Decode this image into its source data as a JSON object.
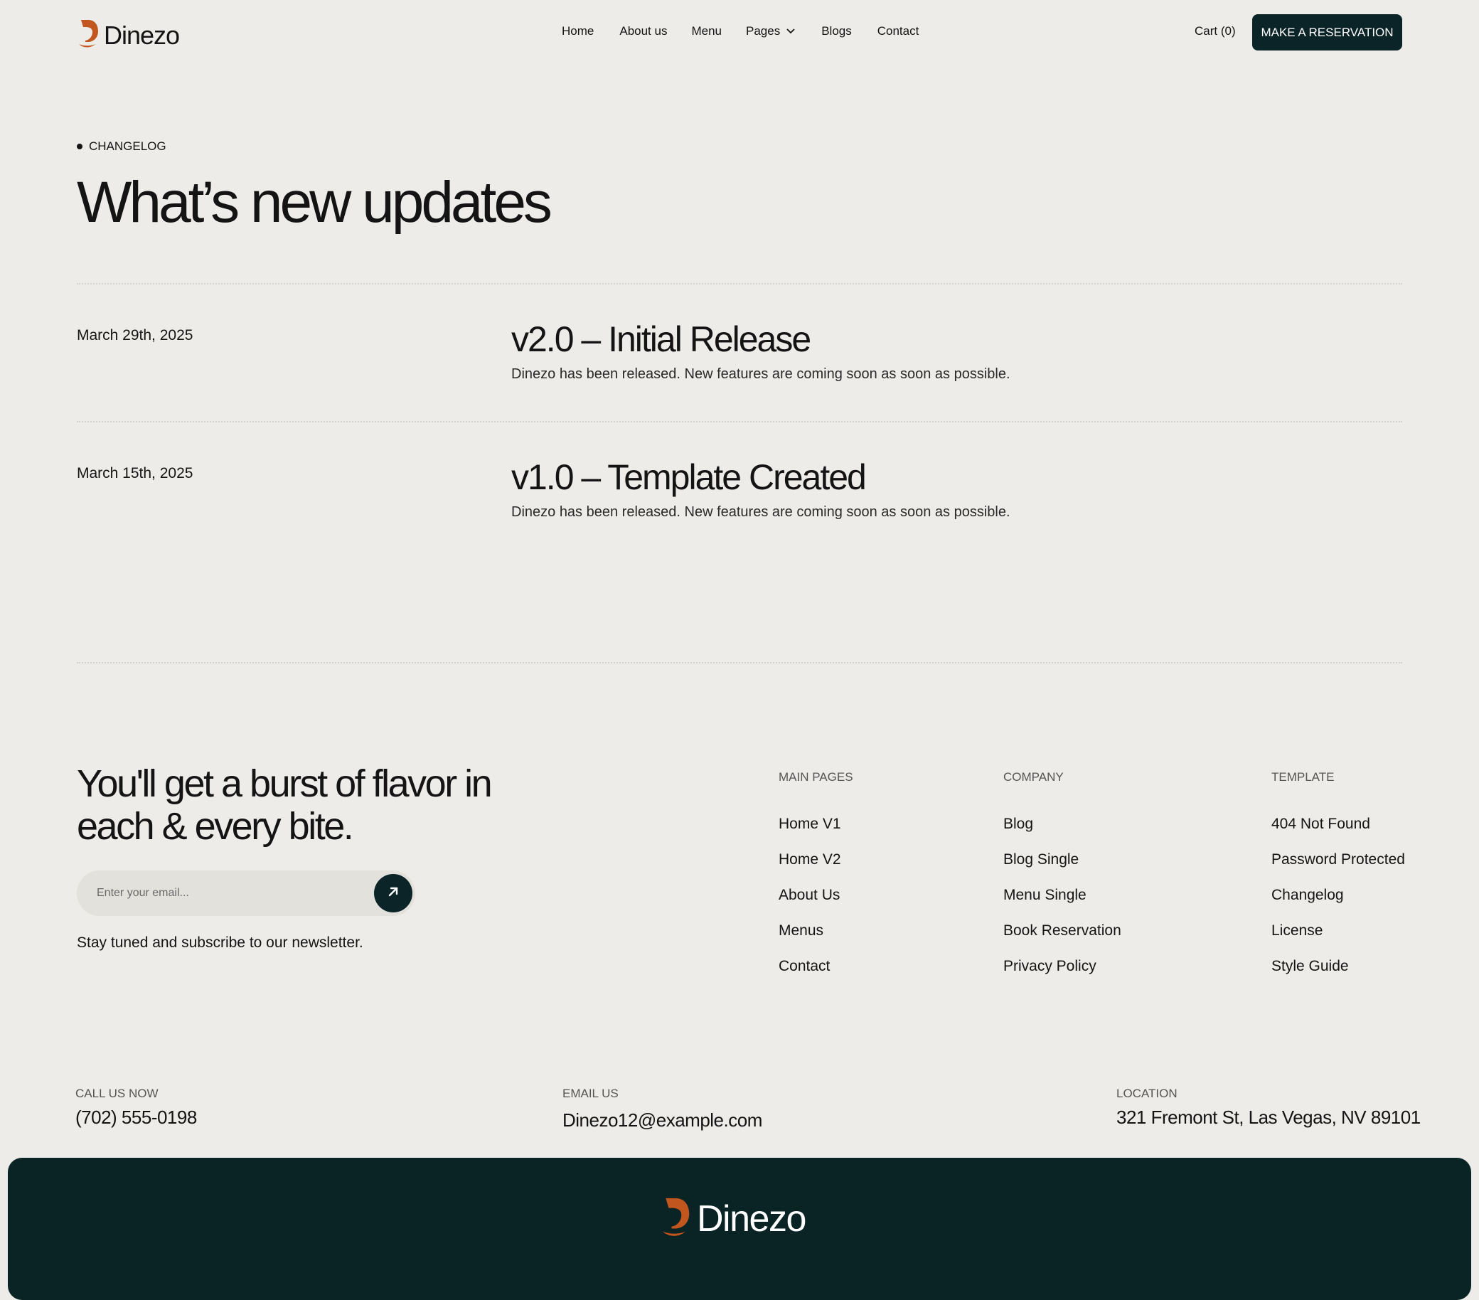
{
  "header": {
    "brand": "Dinezo",
    "nav": [
      "Home",
      "About us",
      "Menu",
      "Pages",
      "Blogs",
      "Contact"
    ],
    "cart_label": "Cart (0)",
    "cta_label": "MAKE A RESERVATION"
  },
  "hero": {
    "eyebrow": "CHANGELOG",
    "title": "What’s new updates"
  },
  "entries": [
    {
      "date": "March 29th, 2025",
      "title": "v2.0 – Initial Release",
      "text": "Dinezo has been released. New features are coming soon as soon as possible."
    },
    {
      "date": "March 15th, 2025",
      "title": "v1.0 – Template Created",
      "text": "Dinezo has been released. New features are coming soon as soon as possible."
    }
  ],
  "footer": {
    "tagline_line1": "You'll get a burst of flavor in",
    "tagline_line2": "each & every bite.",
    "email_placeholder": "Enter your email...",
    "newsletter_note": "Stay tuned and subscribe to our newsletter.",
    "columns": [
      {
        "heading": "MAIN PAGES",
        "links": [
          "Home V1",
          "Home V2",
          "About Us",
          "Menus",
          "Contact"
        ]
      },
      {
        "heading": "COMPANY",
        "links": [
          "Blog",
          "Blog Single",
          "Menu Single",
          "Book Reservation",
          "Privacy Policy"
        ]
      },
      {
        "heading": "TEMPLATE",
        "links": [
          "404 Not Found",
          "Password Protected",
          "Changelog",
          "License",
          "Style Guide"
        ]
      }
    ],
    "contact": {
      "call_label": "CALL US NOW",
      "call_value": "(702) 555-0198",
      "email_label": "EMAIL US",
      "email_value": "Dinezo12@example.com",
      "location_label": "LOCATION",
      "location_value": "321 Fremont St, Las Vegas, NV 89101"
    },
    "bottom_brand": "Dinezo"
  },
  "colors": {
    "background": "#EDECE8",
    "dark": "#0B2427",
    "brand_orange": "#C2561F",
    "text": "#141414"
  },
  "icons": {
    "logo": "flame-d-logo-icon",
    "pages_dropdown": "chevron-down-icon",
    "newsletter_submit": "arrow-up-right-icon"
  }
}
